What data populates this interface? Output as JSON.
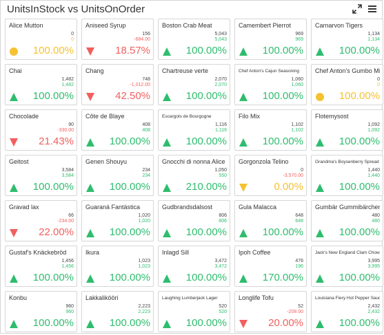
{
  "title": "UnitsInStock vs UnitsOnOrder",
  "icons": {
    "expand": "expand-icon",
    "menu": "hamburger-menu-icon"
  },
  "colors": {
    "up": "#2ebd6e",
    "down": "#f25f5f",
    "zero": "#f5c230"
  },
  "tiles": [
    {
      "name": "Alice Mutton",
      "v1": "0",
      "v2": "0",
      "pct": "100.00%",
      "status": "zero",
      "small": false
    },
    {
      "name": "Aniseed Syrup",
      "v1": "156",
      "v2": "-684.00",
      "pct": "18.57%",
      "status": "down",
      "small": false
    },
    {
      "name": "Boston Crab Meat",
      "v1": "5,043",
      "v2": "5,043",
      "pct": "100.00%",
      "status": "up",
      "small": false
    },
    {
      "name": "Camembert Pierrot",
      "v1": "969",
      "v2": "969",
      "pct": "100.00%",
      "status": "up",
      "small": false
    },
    {
      "name": "Carnarvon Tigers",
      "v1": "1,134",
      "v2": "1,134",
      "pct": "100.00%",
      "status": "up",
      "small": false
    },
    {
      "name": "Chai",
      "v1": "1,482",
      "v2": "1,482",
      "pct": "100.00%",
      "status": "up",
      "small": false
    },
    {
      "name": "Chang",
      "v1": "748",
      "v2": "-1,012.00",
      "pct": "42.50%",
      "status": "down",
      "small": false
    },
    {
      "name": "Chartreuse verte",
      "v1": "2,070",
      "v2": "2,070",
      "pct": "100.00%",
      "status": "up",
      "small": false
    },
    {
      "name": "Chef Anton's Cajun Seasoning",
      "v1": "1,060",
      "v2": "1,060",
      "pct": "100.00%",
      "status": "up",
      "small": true
    },
    {
      "name": "Chef Anton's Gumbo Mix",
      "v1": "0",
      "v2": "0",
      "pct": "100.00%",
      "status": "zero",
      "small": false
    },
    {
      "name": "Chocolade",
      "v1": "90",
      "v2": "-330.00",
      "pct": "21.43%",
      "status": "down",
      "small": false
    },
    {
      "name": "Côte de Blaye",
      "v1": "408",
      "v2": "408",
      "pct": "100.00%",
      "status": "up",
      "small": false
    },
    {
      "name": "Escargots de Bourgogne",
      "v1": "1,116",
      "v2": "1,116",
      "pct": "100.00%",
      "status": "up",
      "small": true
    },
    {
      "name": "Filo Mix",
      "v1": "1,102",
      "v2": "1,102",
      "pct": "100.00%",
      "status": "up",
      "small": false
    },
    {
      "name": "Flotemysost",
      "v1": "1,092",
      "v2": "1,092",
      "pct": "100.00%",
      "status": "up",
      "small": false
    },
    {
      "name": "Geitost",
      "v1": "3,584",
      "v2": "3,584",
      "pct": "100.00%",
      "status": "up",
      "small": false
    },
    {
      "name": "Genen Shouyu",
      "v1": "234",
      "v2": "234",
      "pct": "100.00%",
      "status": "up",
      "small": false
    },
    {
      "name": "Gnocchi di nonna Alice",
      "v1": "1,050",
      "v2": "550",
      "pct": "210.00%",
      "status": "up",
      "small": false
    },
    {
      "name": "Gorgonzola Telino",
      "v1": "0",
      "v2": "-3,570.00",
      "pct": "0.00%",
      "status": "zero-down",
      "small": false
    },
    {
      "name": "Grandma's Boysenberry Spread",
      "v1": "1,440",
      "v2": "1,440",
      "pct": "100.00%",
      "status": "up",
      "small": true
    },
    {
      "name": "Gravad lax",
      "v1": "66",
      "v2": "-234.00",
      "pct": "22.00%",
      "status": "down",
      "small": false
    },
    {
      "name": "Guaraná Fantástica",
      "v1": "1,020",
      "v2": "1,020",
      "pct": "100.00%",
      "status": "up",
      "small": false
    },
    {
      "name": "Gudbrandsdalsost",
      "v1": "806",
      "v2": "806",
      "pct": "100.00%",
      "status": "up",
      "small": false
    },
    {
      "name": "Gula Malacca",
      "v1": "648",
      "v2": "648",
      "pct": "100.00%",
      "status": "up",
      "small": false
    },
    {
      "name": "Gumbär Gummibärchen",
      "v1": "480",
      "v2": "480",
      "pct": "100.00%",
      "status": "up",
      "small": false
    },
    {
      "name": "Gustaf's Knäckebröd",
      "v1": "1,456",
      "v2": "1,456",
      "pct": "100.00%",
      "status": "up",
      "small": false
    },
    {
      "name": "Ikura",
      "v1": "1,023",
      "v2": "1,023",
      "pct": "100.00%",
      "status": "up",
      "small": false
    },
    {
      "name": "Inlagd Sill",
      "v1": "3,472",
      "v2": "3,472",
      "pct": "100.00%",
      "status": "up",
      "small": false
    },
    {
      "name": "Ipoh Coffee",
      "v1": "476",
      "v2": "196",
      "pct": "170.00%",
      "status": "up",
      "small": false
    },
    {
      "name": "Jack's New England Clam Chowder",
      "v1": "3,995",
      "v2": "3,995",
      "pct": "100.00%",
      "status": "up",
      "small": true
    },
    {
      "name": "Konbu",
      "v1": "960",
      "v2": "960",
      "pct": "100.00%",
      "status": "up",
      "small": false
    },
    {
      "name": "Lakkalikööri",
      "v1": "2,223",
      "v2": "2,223",
      "pct": "100.00%",
      "status": "up",
      "small": false
    },
    {
      "name": "Laughing Lumberjack Lager",
      "v1": "520",
      "v2": "520",
      "pct": "100.00%",
      "status": "up",
      "small": true
    },
    {
      "name": "Longlife Tofu",
      "v1": "52",
      "v2": "-208.00",
      "pct": "20.00%",
      "status": "down",
      "small": false
    },
    {
      "name": "Louisiana Fiery Hot Pepper Sauce",
      "v1": "2,432",
      "v2": "2,432",
      "pct": "100.00%",
      "status": "up",
      "small": true
    }
  ]
}
